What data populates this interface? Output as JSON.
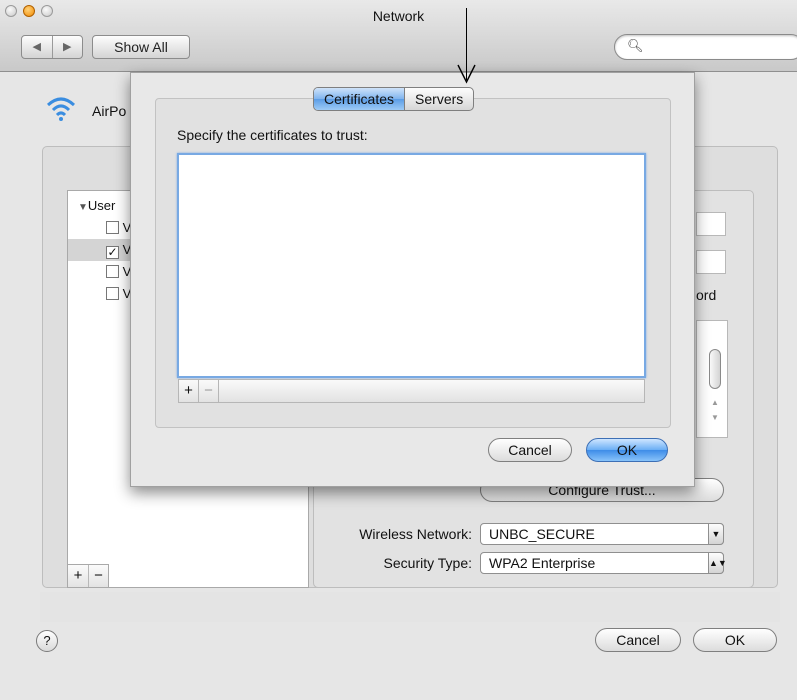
{
  "window": {
    "title": "Network",
    "show_all": "Show All",
    "search_placeholder": ""
  },
  "sidebar_header": {
    "label": "AirPo"
  },
  "identity_list": {
    "group_label": "User",
    "items": [
      {
        "letter": "V",
        "checked": false
      },
      {
        "letter": "V",
        "checked": true
      },
      {
        "letter": "V",
        "checked": false
      },
      {
        "letter": "V",
        "checked": false
      }
    ],
    "add": "+",
    "remove": "−"
  },
  "right_pane": {
    "password_suffix": "ord",
    "configure_trust": "Configure Trust...",
    "wireless_network_label": "Wireless Network:",
    "wireless_network_value": "UNBC_SECURE",
    "security_type_label": "Security Type:",
    "security_type_value": "WPA2 Enterprise"
  },
  "footer": {
    "help": "?",
    "cancel": "Cancel",
    "ok": "OK"
  },
  "sheet": {
    "tabs": [
      {
        "label": "Certificates",
        "selected": true
      },
      {
        "label": "Servers",
        "selected": false
      }
    ],
    "instruction": "Specify the certificates to trust:",
    "add": "+",
    "remove": "−",
    "cancel": "Cancel",
    "ok": "OK"
  },
  "colors": {
    "accent_blue": "#5b9de6",
    "focus_ring": "#78a9e3"
  }
}
